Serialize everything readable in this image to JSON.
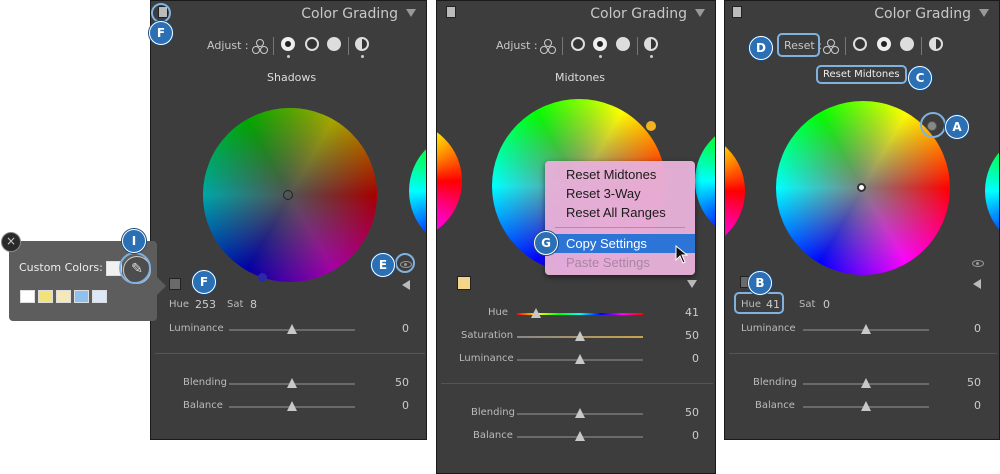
{
  "panels": [
    {
      "title": "Color Grading",
      "adjust_label": "Adjust :",
      "wheel_title": "Shadows",
      "hue_label": "Hue",
      "hue_value": "253",
      "sat_label": "Sat",
      "sat_value": "8",
      "luminance_label": "Luminance",
      "luminance_value": "0",
      "blending_label": "Blending",
      "blending_value": "50",
      "balance_label": "Balance",
      "balance_value": "0"
    },
    {
      "title": "Color Grading",
      "adjust_label": "Adjust :",
      "wheel_title": "Midtones",
      "hue_label": "Hue",
      "hue_value": "41",
      "saturation_label": "Saturation",
      "saturation_value": "50",
      "luminance_label": "Luminance",
      "luminance_value": "0",
      "blending_label": "Blending",
      "blending_value": "50",
      "balance_label": "Balance",
      "balance_value": "0"
    },
    {
      "title": "Color Grading",
      "reset_label": "Reset :",
      "tooltip": "Reset Midtones",
      "hue_label": "Hue",
      "hue_value": "41",
      "sat_label": "Sat",
      "sat_value": "0",
      "luminance_label": "Luminance",
      "luminance_value": "0",
      "blending_label": "Blending",
      "blending_value": "50",
      "balance_label": "Balance",
      "balance_value": "0"
    }
  ],
  "popup": {
    "label": "Custom Colors:",
    "close_glyph": "×",
    "swatches": [
      "#ffffff",
      "#f3e27a",
      "#f6e7b8",
      "#8ec1ef",
      "#dbe8fa"
    ]
  },
  "context_menu": {
    "items": [
      "Reset Midtones",
      "Reset 3-Way",
      "Reset All Ranges",
      "Copy Settings",
      "Paste Settings"
    ],
    "highlighted": "Copy Settings",
    "disabled": "Paste Settings"
  },
  "callouts": [
    "F",
    "F",
    "I",
    "E",
    "G",
    "D",
    "C",
    "A",
    "B"
  ],
  "colors": {
    "panel_bg": "#3d3d3d",
    "callout_bg": "#2b6fb5",
    "highlight": "#7fb2e0",
    "menu_highlight": "#2c74d6",
    "midtone_swatch": "#f6d48a"
  }
}
